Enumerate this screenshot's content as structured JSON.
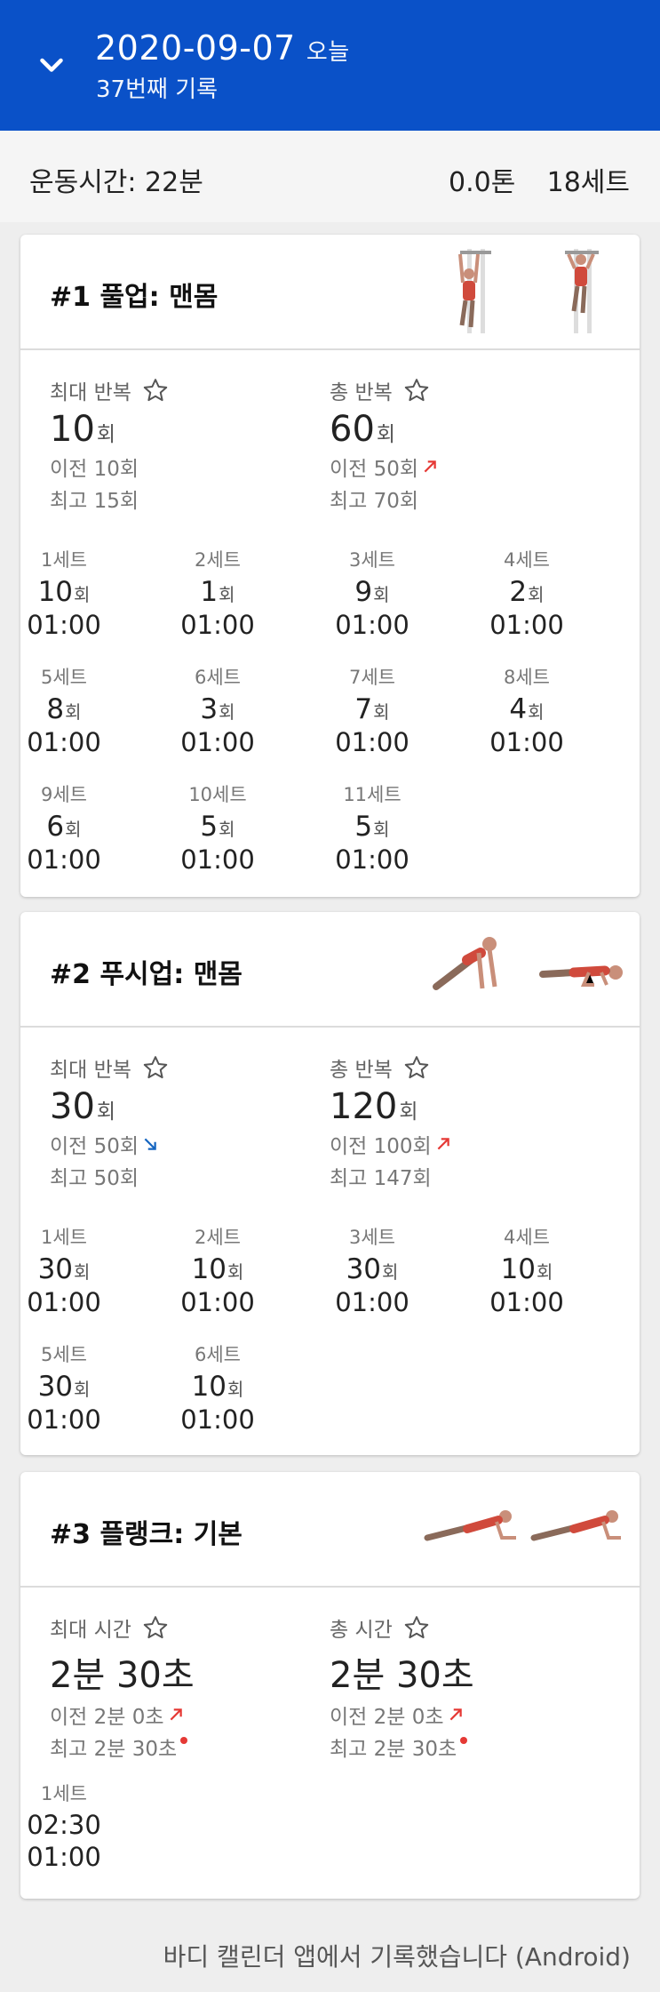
{
  "header": {
    "date": "2020-09-07",
    "today_label": "오늘",
    "subtitle": "37번째 기록"
  },
  "summary": {
    "duration": "운동시간: 22분",
    "tonnage": "0.0톤",
    "sets": "18세트"
  },
  "exercises": [
    {
      "title": "#1 풀업: 맨몸",
      "image_icon": "pull-up-figure",
      "max": {
        "label": "최대 반복",
        "value": "10",
        "unit": "회",
        "prev": "이전 10회",
        "best": "최고 15회"
      },
      "total": {
        "label": "총 반복",
        "value": "60",
        "unit": "회",
        "prev": "이전 50회",
        "best": "최고 70회"
      },
      "sets": [
        {
          "label": "1세트",
          "reps": "10",
          "unit": "회",
          "time": "01:00"
        },
        {
          "label": "2세트",
          "reps": "1",
          "unit": "회",
          "time": "01:00"
        },
        {
          "label": "3세트",
          "reps": "9",
          "unit": "회",
          "time": "01:00"
        },
        {
          "label": "4세트",
          "reps": "2",
          "unit": "회",
          "time": "01:00"
        },
        {
          "label": "5세트",
          "reps": "8",
          "unit": "회",
          "time": "01:00"
        },
        {
          "label": "6세트",
          "reps": "3",
          "unit": "회",
          "time": "01:00"
        },
        {
          "label": "7세트",
          "reps": "7",
          "unit": "회",
          "time": "01:00"
        },
        {
          "label": "8세트",
          "reps": "4",
          "unit": "회",
          "time": "01:00"
        },
        {
          "label": "9세트",
          "reps": "6",
          "unit": "회",
          "time": "01:00"
        },
        {
          "label": "10세트",
          "reps": "5",
          "unit": "회",
          "time": "01:00"
        },
        {
          "label": "11세트",
          "reps": "5",
          "unit": "회",
          "time": "01:00"
        }
      ]
    },
    {
      "title": "#2 푸시업: 맨몸",
      "image_icon": "push-up-figure",
      "max": {
        "label": "최대 반복",
        "value": "30",
        "unit": "회",
        "prev": "이전 50회",
        "best": "최고 50회"
      },
      "total": {
        "label": "총 반복",
        "value": "120",
        "unit": "회",
        "prev": "이전 100회",
        "best": "최고 147회"
      },
      "sets": [
        {
          "label": "1세트",
          "reps": "30",
          "unit": "회",
          "time": "01:00"
        },
        {
          "label": "2세트",
          "reps": "10",
          "unit": "회",
          "time": "01:00"
        },
        {
          "label": "3세트",
          "reps": "30",
          "unit": "회",
          "time": "01:00"
        },
        {
          "label": "4세트",
          "reps": "10",
          "unit": "회",
          "time": "01:00"
        },
        {
          "label": "5세트",
          "reps": "30",
          "unit": "회",
          "time": "01:00"
        },
        {
          "label": "6세트",
          "reps": "10",
          "unit": "회",
          "time": "01:00"
        }
      ]
    },
    {
      "title": "#3 플랭크: 기본",
      "image_icon": "plank-figure",
      "max": {
        "label": "최대 시간",
        "value": "2분 30초",
        "prev": "이전 2분 0초",
        "best": "최고 2분 30초"
      },
      "total": {
        "label": "총 시간",
        "value": "2분 30초",
        "prev": "이전 2분 0초",
        "best": "최고 2분 30초"
      },
      "sets": [
        {
          "label": "1세트",
          "duration": "02:30",
          "time": "01:00"
        }
      ]
    }
  ],
  "colors": {
    "header_bg": "#0a51c8",
    "arrow_up": "#e53935",
    "arrow_down": "#1565c0"
  },
  "footer": "바디 캘린더 앱에서 기록했습니다 (Android)"
}
